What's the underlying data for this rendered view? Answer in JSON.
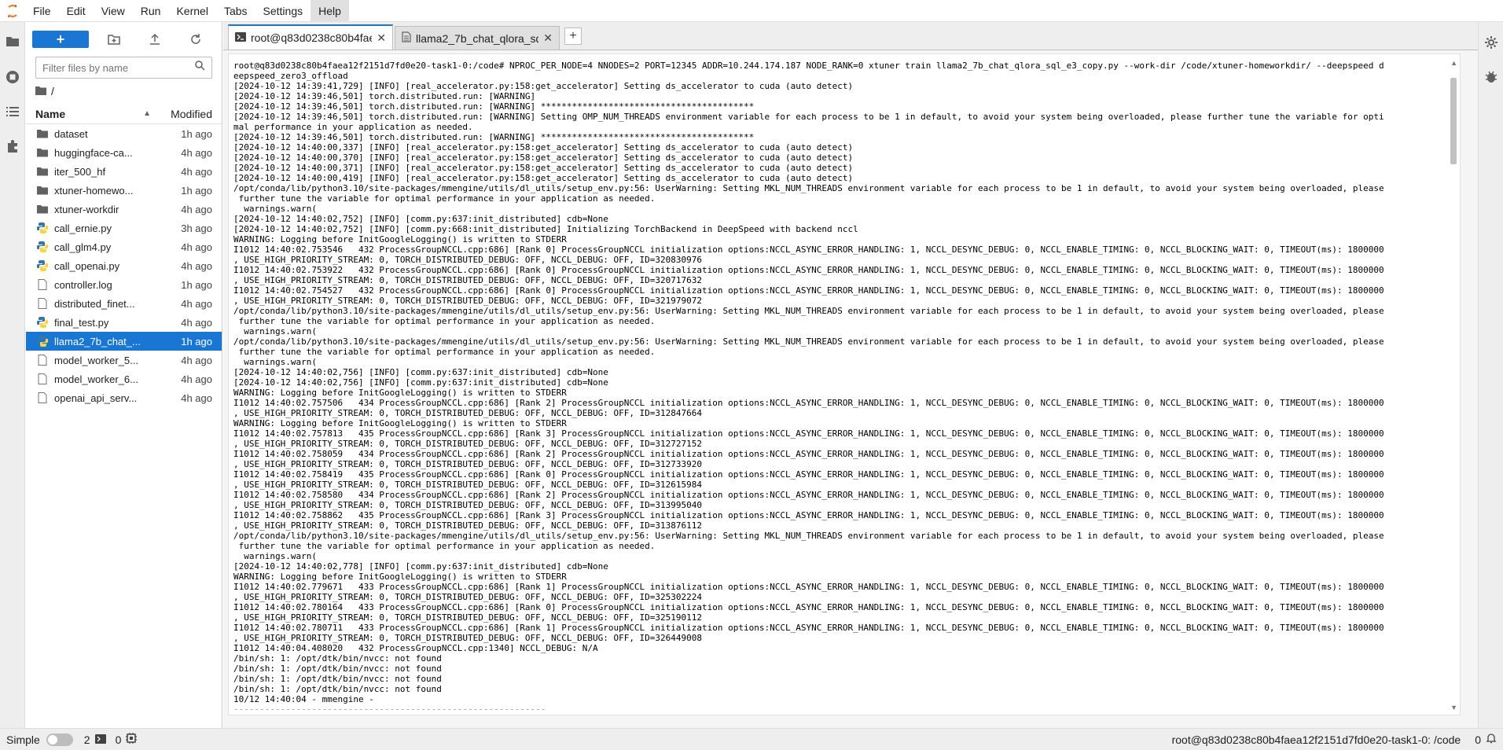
{
  "menubar": {
    "items": [
      "File",
      "Edit",
      "View",
      "Run",
      "Kernel",
      "Tabs",
      "Settings",
      "Help"
    ],
    "active_index": 7
  },
  "filebrowser": {
    "new_label": "+",
    "search_placeholder": "Filter files by name",
    "breadcrumb": "/",
    "header": {
      "name": "Name",
      "modified": "Modified"
    },
    "files": [
      {
        "name": "dataset",
        "modified": "1h ago",
        "type": "folder"
      },
      {
        "name": "huggingface-ca...",
        "modified": "4h ago",
        "type": "folder"
      },
      {
        "name": "iter_500_hf",
        "modified": "4h ago",
        "type": "folder"
      },
      {
        "name": "xtuner-homewo...",
        "modified": "1h ago",
        "type": "folder"
      },
      {
        "name": "xtuner-workdir",
        "modified": "4h ago",
        "type": "folder"
      },
      {
        "name": "call_ernie.py",
        "modified": "3h ago",
        "type": "python"
      },
      {
        "name": "call_glm4.py",
        "modified": "4h ago",
        "type": "python"
      },
      {
        "name": "call_openai.py",
        "modified": "4h ago",
        "type": "python"
      },
      {
        "name": "controller.log",
        "modified": "1h ago",
        "type": "file"
      },
      {
        "name": "distributed_finet...",
        "modified": "4h ago",
        "type": "file"
      },
      {
        "name": "final_test.py",
        "modified": "4h ago",
        "type": "python"
      },
      {
        "name": "llama2_7b_chat_...",
        "modified": "1h ago",
        "type": "python",
        "selected": true
      },
      {
        "name": "model_worker_5...",
        "modified": "4h ago",
        "type": "file"
      },
      {
        "name": "model_worker_6...",
        "modified": "4h ago",
        "type": "file"
      },
      {
        "name": "openai_api_serv...",
        "modified": "4h ago",
        "type": "file"
      }
    ]
  },
  "tabs": [
    {
      "label": "root@q83d0238c80b4faea",
      "active": true
    },
    {
      "label": "llama2_7b_chat_qlora_sql_",
      "active": false
    }
  ],
  "terminal": {
    "lines": [
      "root@q83d0238c80b4faea12f2151d7fd0e20-task1-0:/code# NPROC_PER_NODE=4 NNODES=2 PORT=12345 ADDR=10.244.174.187 NODE_RANK=0 xtuner train llama2_7b_chat_qlora_sql_e3_copy.py --work-dir /code/xtuner-homeworkdir/ --deepspeed d",
      "eepspeed_zero3_offload",
      "[2024-10-12 14:39:41,729] [INFO] [real_accelerator.py:158:get_accelerator] Setting ds_accelerator to cuda (auto detect)",
      "[2024-10-12 14:39:46,501] torch.distributed.run: [WARNING]",
      "[2024-10-12 14:39:46,501] torch.distributed.run: [WARNING] *****************************************",
      "[2024-10-12 14:39:46,501] torch.distributed.run: [WARNING] Setting OMP_NUM_THREADS environment variable for each process to be 1 in default, to avoid your system being overloaded, please further tune the variable for opti",
      "mal performance in your application as needed.",
      "[2024-10-12 14:39:46,501] torch.distributed.run: [WARNING] *****************************************",
      "[2024-10-12 14:40:00,337] [INFO] [real_accelerator.py:158:get_accelerator] Setting ds_accelerator to cuda (auto detect)",
      "[2024-10-12 14:40:00,370] [INFO] [real_accelerator.py:158:get_accelerator] Setting ds_accelerator to cuda (auto detect)",
      "[2024-10-12 14:40:00,371] [INFO] [real_accelerator.py:158:get_accelerator] Setting ds_accelerator to cuda (auto detect)",
      "[2024-10-12 14:40:00,419] [INFO] [real_accelerator.py:158:get_accelerator] Setting ds_accelerator to cuda (auto detect)",
      "/opt/conda/lib/python3.10/site-packages/mmengine/utils/dl_utils/setup_env.py:56: UserWarning: Setting MKL_NUM_THREADS environment variable for each process to be 1 in default, to avoid your system being overloaded, please",
      " further tune the variable for optimal performance in your application as needed.",
      "  warnings.warn(",
      "[2024-10-12 14:40:02,752] [INFO] [comm.py:637:init_distributed] cdb=None",
      "[2024-10-12 14:40:02,752] [INFO] [comm.py:668:init_distributed] Initializing TorchBackend in DeepSpeed with backend nccl",
      "WARNING: Logging before InitGoogleLogging() is written to STDERR",
      "I1012 14:40:02.753546   432 ProcessGroupNCCL.cpp:686] [Rank 0] ProcessGroupNCCL initialization options:NCCL_ASYNC_ERROR_HANDLING: 1, NCCL_DESYNC_DEBUG: 0, NCCL_ENABLE_TIMING: 0, NCCL_BLOCKING_WAIT: 0, TIMEOUT(ms): 1800000",
      ", USE_HIGH_PRIORITY_STREAM: 0, TORCH_DISTRIBUTED_DEBUG: OFF, NCCL_DEBUG: OFF, ID=320830976",
      "I1012 14:40:02.753922   432 ProcessGroupNCCL.cpp:686] [Rank 0] ProcessGroupNCCL initialization options:NCCL_ASYNC_ERROR_HANDLING: 1, NCCL_DESYNC_DEBUG: 0, NCCL_ENABLE_TIMING: 0, NCCL_BLOCKING_WAIT: 0, TIMEOUT(ms): 1800000",
      ", USE_HIGH_PRIORITY_STREAM: 0, TORCH_DISTRIBUTED_DEBUG: OFF, NCCL_DEBUG: OFF, ID=320717632",
      "I1012 14:40:02.754527   432 ProcessGroupNCCL.cpp:686] [Rank 0] ProcessGroupNCCL initialization options:NCCL_ASYNC_ERROR_HANDLING: 1, NCCL_DESYNC_DEBUG: 0, NCCL_ENABLE_TIMING: 0, NCCL_BLOCKING_WAIT: 0, TIMEOUT(ms): 1800000",
      ", USE_HIGH_PRIORITY_STREAM: 0, TORCH_DISTRIBUTED_DEBUG: OFF, NCCL_DEBUG: OFF, ID=321979072",
      "/opt/conda/lib/python3.10/site-packages/mmengine/utils/dl_utils/setup_env.py:56: UserWarning: Setting MKL_NUM_THREADS environment variable for each process to be 1 in default, to avoid your system being overloaded, please",
      " further tune the variable for optimal performance in your application as needed.",
      "  warnings.warn(",
      "/opt/conda/lib/python3.10/site-packages/mmengine/utils/dl_utils/setup_env.py:56: UserWarning: Setting MKL_NUM_THREADS environment variable for each process to be 1 in default, to avoid your system being overloaded, please",
      " further tune the variable for optimal performance in your application as needed.",
      "  warnings.warn(",
      "[2024-10-12 14:40:02,756] [INFO] [comm.py:637:init_distributed] cdb=None",
      "[2024-10-12 14:40:02,756] [INFO] [comm.py:637:init_distributed] cdb=None",
      "WARNING: Logging before InitGoogleLogging() is written to STDERR",
      "I1012 14:40:02.757506   434 ProcessGroupNCCL.cpp:686] [Rank 2] ProcessGroupNCCL initialization options:NCCL_ASYNC_ERROR_HANDLING: 1, NCCL_DESYNC_DEBUG: 0, NCCL_ENABLE_TIMING: 0, NCCL_BLOCKING_WAIT: 0, TIMEOUT(ms): 1800000",
      ", USE_HIGH_PRIORITY_STREAM: 0, TORCH_DISTRIBUTED_DEBUG: OFF, NCCL_DEBUG: OFF, ID=312847664",
      "WARNING: Logging before InitGoogleLogging() is written to STDERR",
      "I1012 14:40:02.757813   435 ProcessGroupNCCL.cpp:686] [Rank 3] ProcessGroupNCCL initialization options:NCCL_ASYNC_ERROR_HANDLING: 1, NCCL_DESYNC_DEBUG: 0, NCCL_ENABLE_TIMING: 0, NCCL_BLOCKING_WAIT: 0, TIMEOUT(ms): 1800000",
      ", USE_HIGH_PRIORITY_STREAM: 0, TORCH_DISTRIBUTED_DEBUG: OFF, NCCL_DEBUG: OFF, ID=312727152",
      "I1012 14:40:02.758059   434 ProcessGroupNCCL.cpp:686] [Rank 2] ProcessGroupNCCL initialization options:NCCL_ASYNC_ERROR_HANDLING: 1, NCCL_DESYNC_DEBUG: 0, NCCL_ENABLE_TIMING: 0, NCCL_BLOCKING_WAIT: 0, TIMEOUT(ms): 1800000",
      ", USE_HIGH_PRIORITY_STREAM: 0, TORCH_DISTRIBUTED_DEBUG: OFF, NCCL_DEBUG: OFF, ID=312733920",
      "I1012 14:40:02.758419   435 ProcessGroupNCCL.cpp:686] [Rank 0] ProcessGroupNCCL initialization options:NCCL_ASYNC_ERROR_HANDLING: 1, NCCL_DESYNC_DEBUG: 0, NCCL_ENABLE_TIMING: 0, NCCL_BLOCKING_WAIT: 0, TIMEOUT(ms): 1800000",
      ", USE_HIGH_PRIORITY_STREAM: 0, TORCH_DISTRIBUTED_DEBUG: OFF, NCCL_DEBUG: OFF, ID=312615984",
      "I1012 14:40:02.758580   434 ProcessGroupNCCL.cpp:686] [Rank 2] ProcessGroupNCCL initialization options:NCCL_ASYNC_ERROR_HANDLING: 1, NCCL_DESYNC_DEBUG: 0, NCCL_ENABLE_TIMING: 0, NCCL_BLOCKING_WAIT: 0, TIMEOUT(ms): 1800000",
      ", USE_HIGH_PRIORITY_STREAM: 0, TORCH_DISTRIBUTED_DEBUG: OFF, NCCL_DEBUG: OFF, ID=313995040",
      "I1012 14:40:02.758862   435 ProcessGroupNCCL.cpp:686] [Rank 3] ProcessGroupNCCL initialization options:NCCL_ASYNC_ERROR_HANDLING: 1, NCCL_DESYNC_DEBUG: 0, NCCL_ENABLE_TIMING: 0, NCCL_BLOCKING_WAIT: 0, TIMEOUT(ms): 1800000",
      ", USE_HIGH_PRIORITY_STREAM: 0, TORCH_DISTRIBUTED_DEBUG: OFF, NCCL_DEBUG: OFF, ID=313876112",
      "/opt/conda/lib/python3.10/site-packages/mmengine/utils/dl_utils/setup_env.py:56: UserWarning: Setting MKL_NUM_THREADS environment variable for each process to be 1 in default, to avoid your system being overloaded, please",
      " further tune the variable for optimal performance in your application as needed.",
      "  warnings.warn(",
      "[2024-10-12 14:40:02,778] [INFO] [comm.py:637:init_distributed] cdb=None",
      "WARNING: Logging before InitGoogleLogging() is written to STDERR",
      "I1012 14:40:02.779671   433 ProcessGroupNCCL.cpp:686] [Rank 1] ProcessGroupNCCL initialization options:NCCL_ASYNC_ERROR_HANDLING: 1, NCCL_DESYNC_DEBUG: 0, NCCL_ENABLE_TIMING: 0, NCCL_BLOCKING_WAIT: 0, TIMEOUT(ms): 1800000",
      ", USE_HIGH_PRIORITY_STREAM: 0, TORCH_DISTRIBUTED_DEBUG: OFF, NCCL_DEBUG: OFF, ID=325302224",
      "I1012 14:40:02.780164   433 ProcessGroupNCCL.cpp:686] [Rank 0] ProcessGroupNCCL initialization options:NCCL_ASYNC_ERROR_HANDLING: 1, NCCL_DESYNC_DEBUG: 0, NCCL_ENABLE_TIMING: 0, NCCL_BLOCKING_WAIT: 0, TIMEOUT(ms): 1800000",
      ", USE_HIGH_PRIORITY_STREAM: 0, TORCH_DISTRIBUTED_DEBUG: OFF, NCCL_DEBUG: OFF, ID=325190112",
      "I1012 14:40:02.780711   433 ProcessGroupNCCL.cpp:686] [Rank 1] ProcessGroupNCCL initialization options:NCCL_ASYNC_ERROR_HANDLING: 1, NCCL_DESYNC_DEBUG: 0, NCCL_ENABLE_TIMING: 0, NCCL_BLOCKING_WAIT: 0, TIMEOUT(ms): 1800000",
      ", USE_HIGH_PRIORITY_STREAM: 0, TORCH_DISTRIBUTED_DEBUG: OFF, NCCL_DEBUG: OFF, ID=326449008",
      "I1012 14:40:04.408020   432 ProcessGroupNCCL.cpp:1340] NCCL_DEBUG: N/A",
      "/bin/sh: 1: /opt/dtk/bin/nvcc: not found",
      "/bin/sh: 1: /opt/dtk/bin/nvcc: not found",
      "/bin/sh: 1: /opt/dtk/bin/nvcc: not found",
      "/bin/sh: 1: /opt/dtk/bin/nvcc: not found",
      "10/12 14:40:04 - mmengine - ",
      "------------------------------------------------------------"
    ]
  },
  "statusbar": {
    "mode_label": "Simple",
    "terminals_count": "2",
    "kernels_count": "0",
    "right_text": "root@q83d0238c80b4faea12f2151d7fd0e20-task1-0: /code",
    "notifications_count": "0"
  }
}
